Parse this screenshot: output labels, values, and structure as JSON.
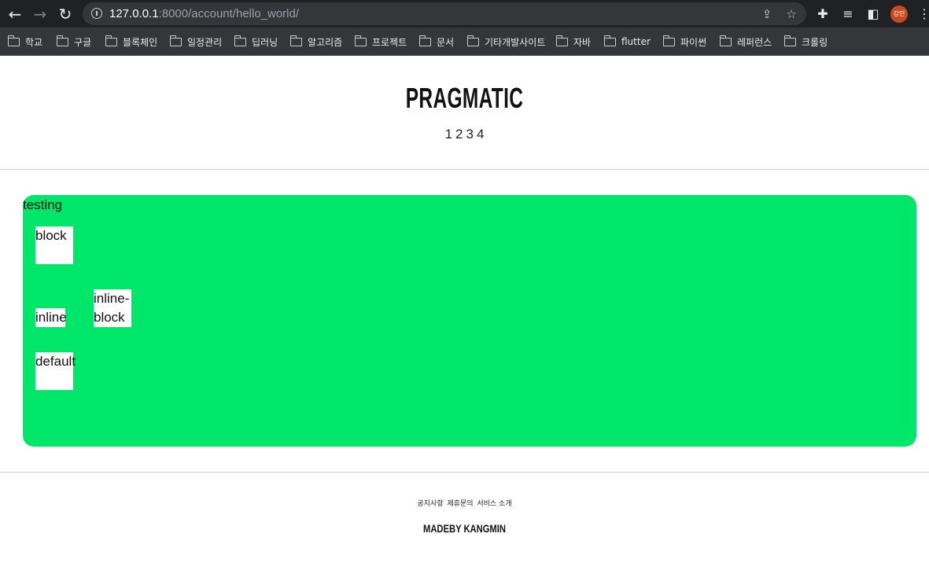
{
  "browser": {
    "url_host": "127.0.0.1",
    "url_path": ":8000/account/hello_world/",
    "avatar_text": "강민",
    "bookmarks": [
      "학교",
      "구글",
      "블록체인",
      "일정관리",
      "딥러닝",
      "알고리즘",
      "프로젝트",
      "문서",
      "기타개발사이트",
      "자바",
      "flutter",
      "파이썬",
      "레퍼런스",
      "크롤링"
    ]
  },
  "header": {
    "logo": "PRAGMATIC",
    "nav": [
      "1",
      "2",
      "3",
      "4"
    ]
  },
  "main": {
    "section_label": "testing",
    "background_color": "#00e66b",
    "boxes": {
      "block": "block",
      "inline": "inline",
      "inline_block": "inline-block",
      "default": "default"
    }
  },
  "footer": {
    "links": [
      "공지사항",
      "제휴문의",
      "서비스 소개"
    ],
    "credit": "MADEBY KANGMIN"
  }
}
